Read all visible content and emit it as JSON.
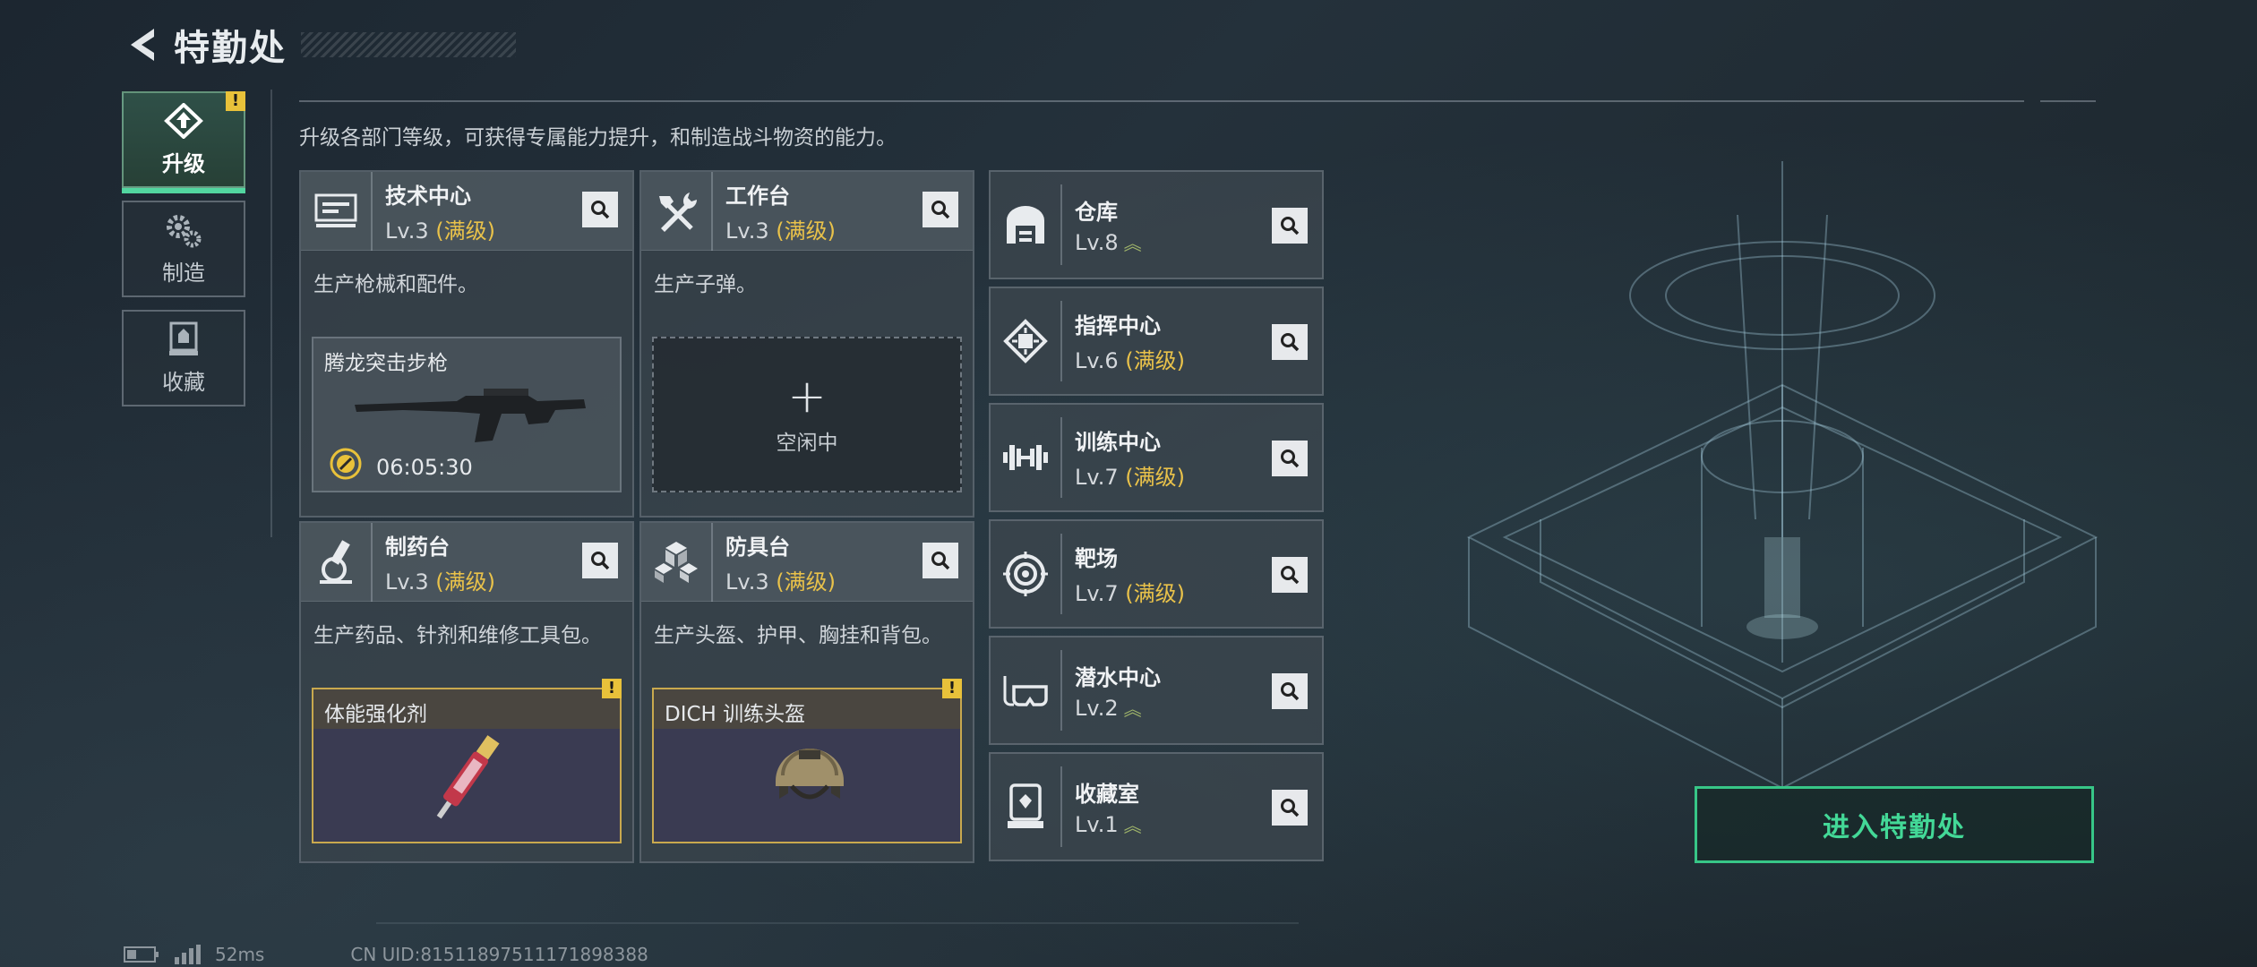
{
  "header": {
    "title": "特勤处"
  },
  "nav": [
    {
      "label": "升级",
      "active": true,
      "icon": "upgrade-icon",
      "badge": "!"
    },
    {
      "label": "制造",
      "active": false,
      "icon": "gears-icon"
    },
    {
      "label": "收藏",
      "active": false,
      "icon": "collection-icon"
    }
  ],
  "description": "升级各部门等级，可获得专属能力提升，和制造战斗物资的能力。",
  "cards": [
    {
      "name": "技术中心",
      "level": "Lv.3",
      "status": "(满级)",
      "desc": "生产枪械和配件。",
      "icon": "tech-center-icon",
      "production": {
        "item": "腾龙突击步枪",
        "time": "06:05:30"
      }
    },
    {
      "name": "工作台",
      "level": "Lv.3",
      "status": "(满级)",
      "desc": "生产子弹。",
      "icon": "workbench-icon",
      "idle": "空闲中"
    },
    {
      "name": "制药台",
      "level": "Lv.3",
      "status": "(满级)",
      "desc": "生产药品、针剂和维修工具包。",
      "icon": "pharmacy-icon",
      "production": {
        "item": "体能强化剂",
        "badge": "!"
      }
    },
    {
      "name": "防具台",
      "level": "Lv.3",
      "status": "(满级)",
      "desc": "生产头盔、护甲、胸挂和背包。",
      "icon": "armor-bench-icon",
      "production": {
        "item": "DICH 训练头盔",
        "badge": "!"
      }
    }
  ],
  "facilities": [
    {
      "name": "仓库",
      "level": "Lv.8",
      "status": "",
      "upgradable": true,
      "icon": "warehouse-icon"
    },
    {
      "name": "指挥中心",
      "level": "Lv.6",
      "status": "(满级)",
      "upgradable": false,
      "icon": "command-center-icon"
    },
    {
      "name": "训练中心",
      "level": "Lv.7",
      "status": "(满级)",
      "upgradable": false,
      "icon": "training-center-icon"
    },
    {
      "name": "靶场",
      "level": "Lv.7",
      "status": "(满级)",
      "upgradable": false,
      "icon": "shooting-range-icon"
    },
    {
      "name": "潜水中心",
      "level": "Lv.2",
      "status": "",
      "upgradable": true,
      "icon": "diving-center-icon"
    },
    {
      "name": "收藏室",
      "level": "Lv.1",
      "status": "",
      "upgradable": true,
      "icon": "collection-room-icon"
    }
  ],
  "enter_button": "进入特勤处",
  "footer": {
    "ping": "52ms",
    "uid": "CN UID:81511897511171898388"
  },
  "colors": {
    "accent": "#43d897",
    "max_level": "#e9c24a",
    "warning": "#e8c13a"
  }
}
